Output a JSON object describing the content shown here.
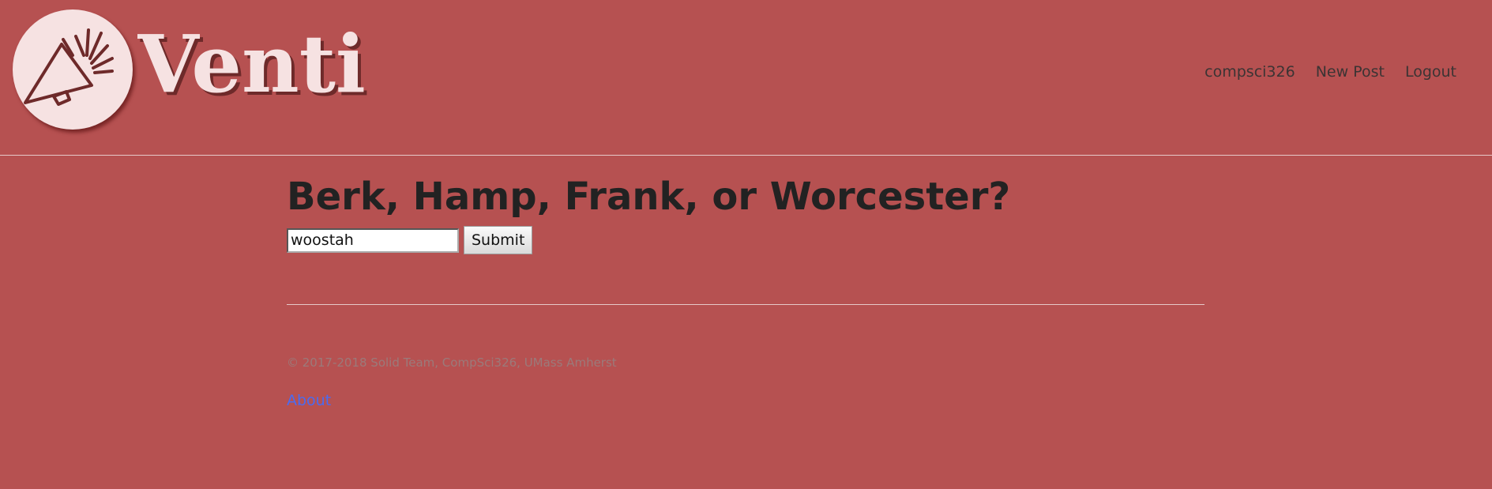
{
  "header": {
    "brand": "Venti",
    "nav": [
      {
        "label": "compsci326"
      },
      {
        "label": "New Post"
      },
      {
        "label": "Logout"
      }
    ]
  },
  "main": {
    "question": "Berk, Hamp, Frank, or Worcester?",
    "answer_value": "woostah",
    "submit_label": "Submit"
  },
  "footer": {
    "copyright": "© 2017-2018 Solid Team, CompSci326, UMass Amherst",
    "about_label": "About"
  },
  "colors": {
    "background": "#b65151",
    "logo_fill": "#f6e2e2",
    "link": "#4b6bf0"
  },
  "icons": {
    "logo": "megaphone-icon"
  }
}
